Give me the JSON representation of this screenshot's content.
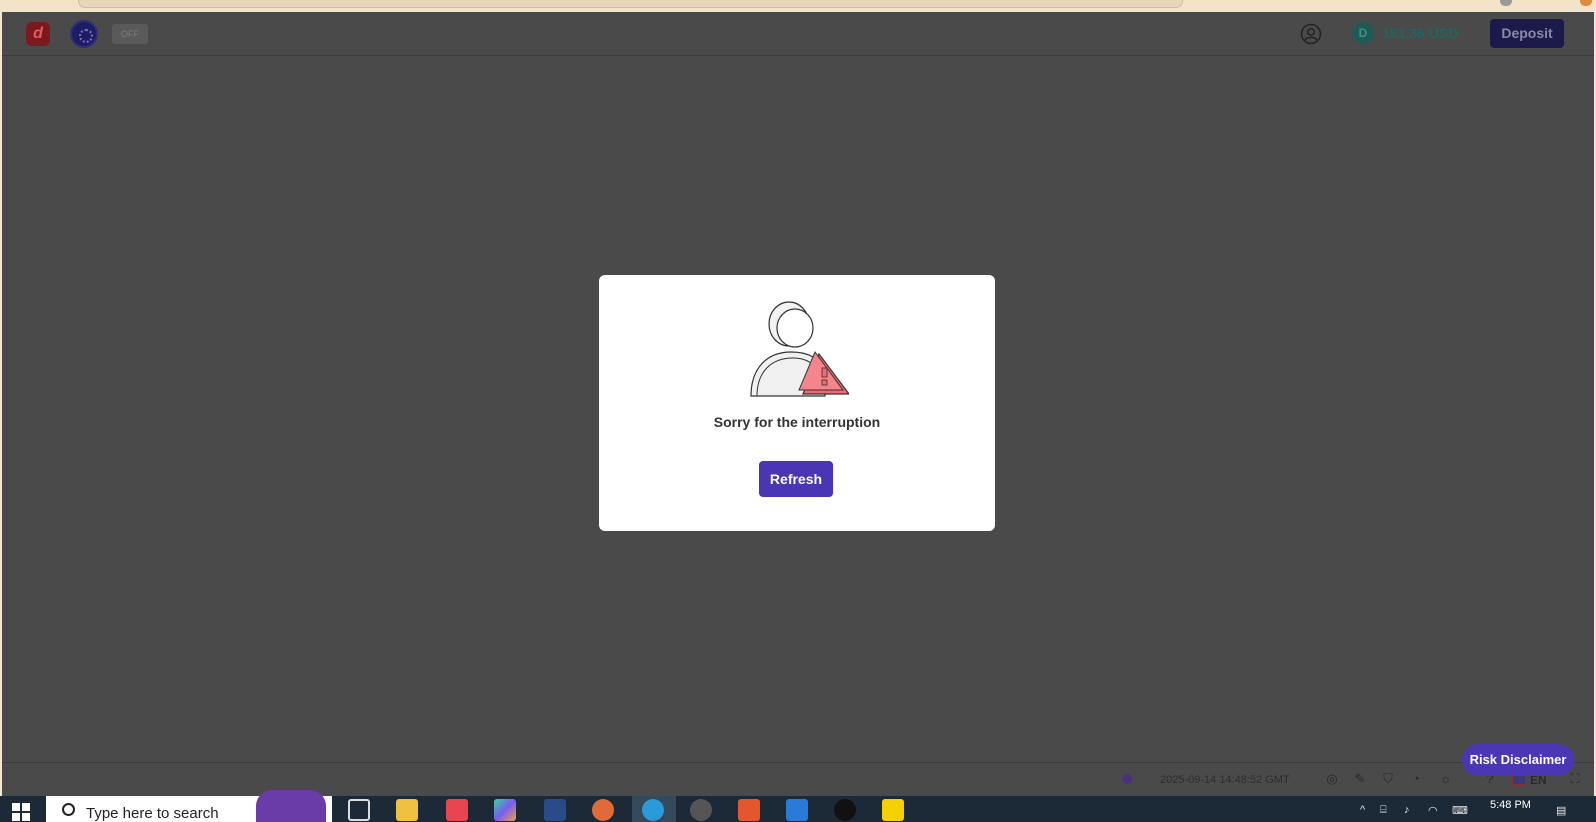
{
  "app": {
    "toggle_label": "OFF",
    "balance_amount": "181.36 USD",
    "balance_coin_glyph": "D",
    "deposit_label": "Deposit"
  },
  "modal": {
    "message": "Sorry for the interruption",
    "refresh_label": "Refresh"
  },
  "footer": {
    "timestamp": "2025-09-14 14:48:52 GMT",
    "language": "EN",
    "risk_disclaimer_label": "Risk Disclaimer"
  },
  "taskbar": {
    "search_placeholder": "Type here to search",
    "time": "5:48 PM"
  },
  "colors": {
    "overlay_bg": "#4a4a4a",
    "primary_button": "#4a35b5",
    "deposit_button": "#1b1a4a",
    "warning_red": "#f06a73"
  }
}
